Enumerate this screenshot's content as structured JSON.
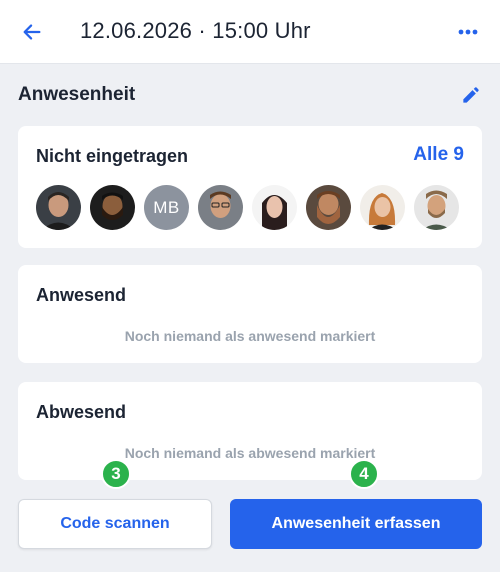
{
  "header": {
    "title": "12.06.2026 · 15:00 Uhr",
    "back_icon": "arrow-left-icon",
    "more_icon": "ellipsis-icon"
  },
  "section": {
    "title": "Anwesenheit",
    "edit_icon": "pencil-icon"
  },
  "not_registered": {
    "title": "Nicht eingetragen",
    "all_link": "Alle 9",
    "avatars": [
      {
        "type": "photo",
        "colors": [
          "#3a3f45",
          "#c99a7d"
        ]
      },
      {
        "type": "photo",
        "colors": [
          "#1d1d1d",
          "#8b5e3c"
        ]
      },
      {
        "type": "initials",
        "initials": "MB"
      },
      {
        "type": "photo",
        "colors": [
          "#7a7f86",
          "#d1a07f"
        ]
      },
      {
        "type": "photo",
        "colors": [
          "#ffffff",
          "#2a1d1d"
        ]
      },
      {
        "type": "photo",
        "colors": [
          "#5a4a3e",
          "#a0643f"
        ]
      },
      {
        "type": "photo",
        "colors": [
          "#f1eee9",
          "#c77a3a"
        ]
      },
      {
        "type": "photo",
        "colors": [
          "#e6e6e6",
          "#8a6a4a"
        ]
      }
    ]
  },
  "present": {
    "title": "Anwesend",
    "empty": "Noch niemand als anwesend markiert"
  },
  "absent": {
    "title": "Abwesend",
    "empty": "Noch niemand als abwesend markiert"
  },
  "badges": {
    "left": "3",
    "right": "4"
  },
  "actions": {
    "scan": "Code scannen",
    "record": "Anwesenheit erfassen"
  },
  "colors": {
    "accent": "#2563eb",
    "badge": "#2bb24c"
  }
}
